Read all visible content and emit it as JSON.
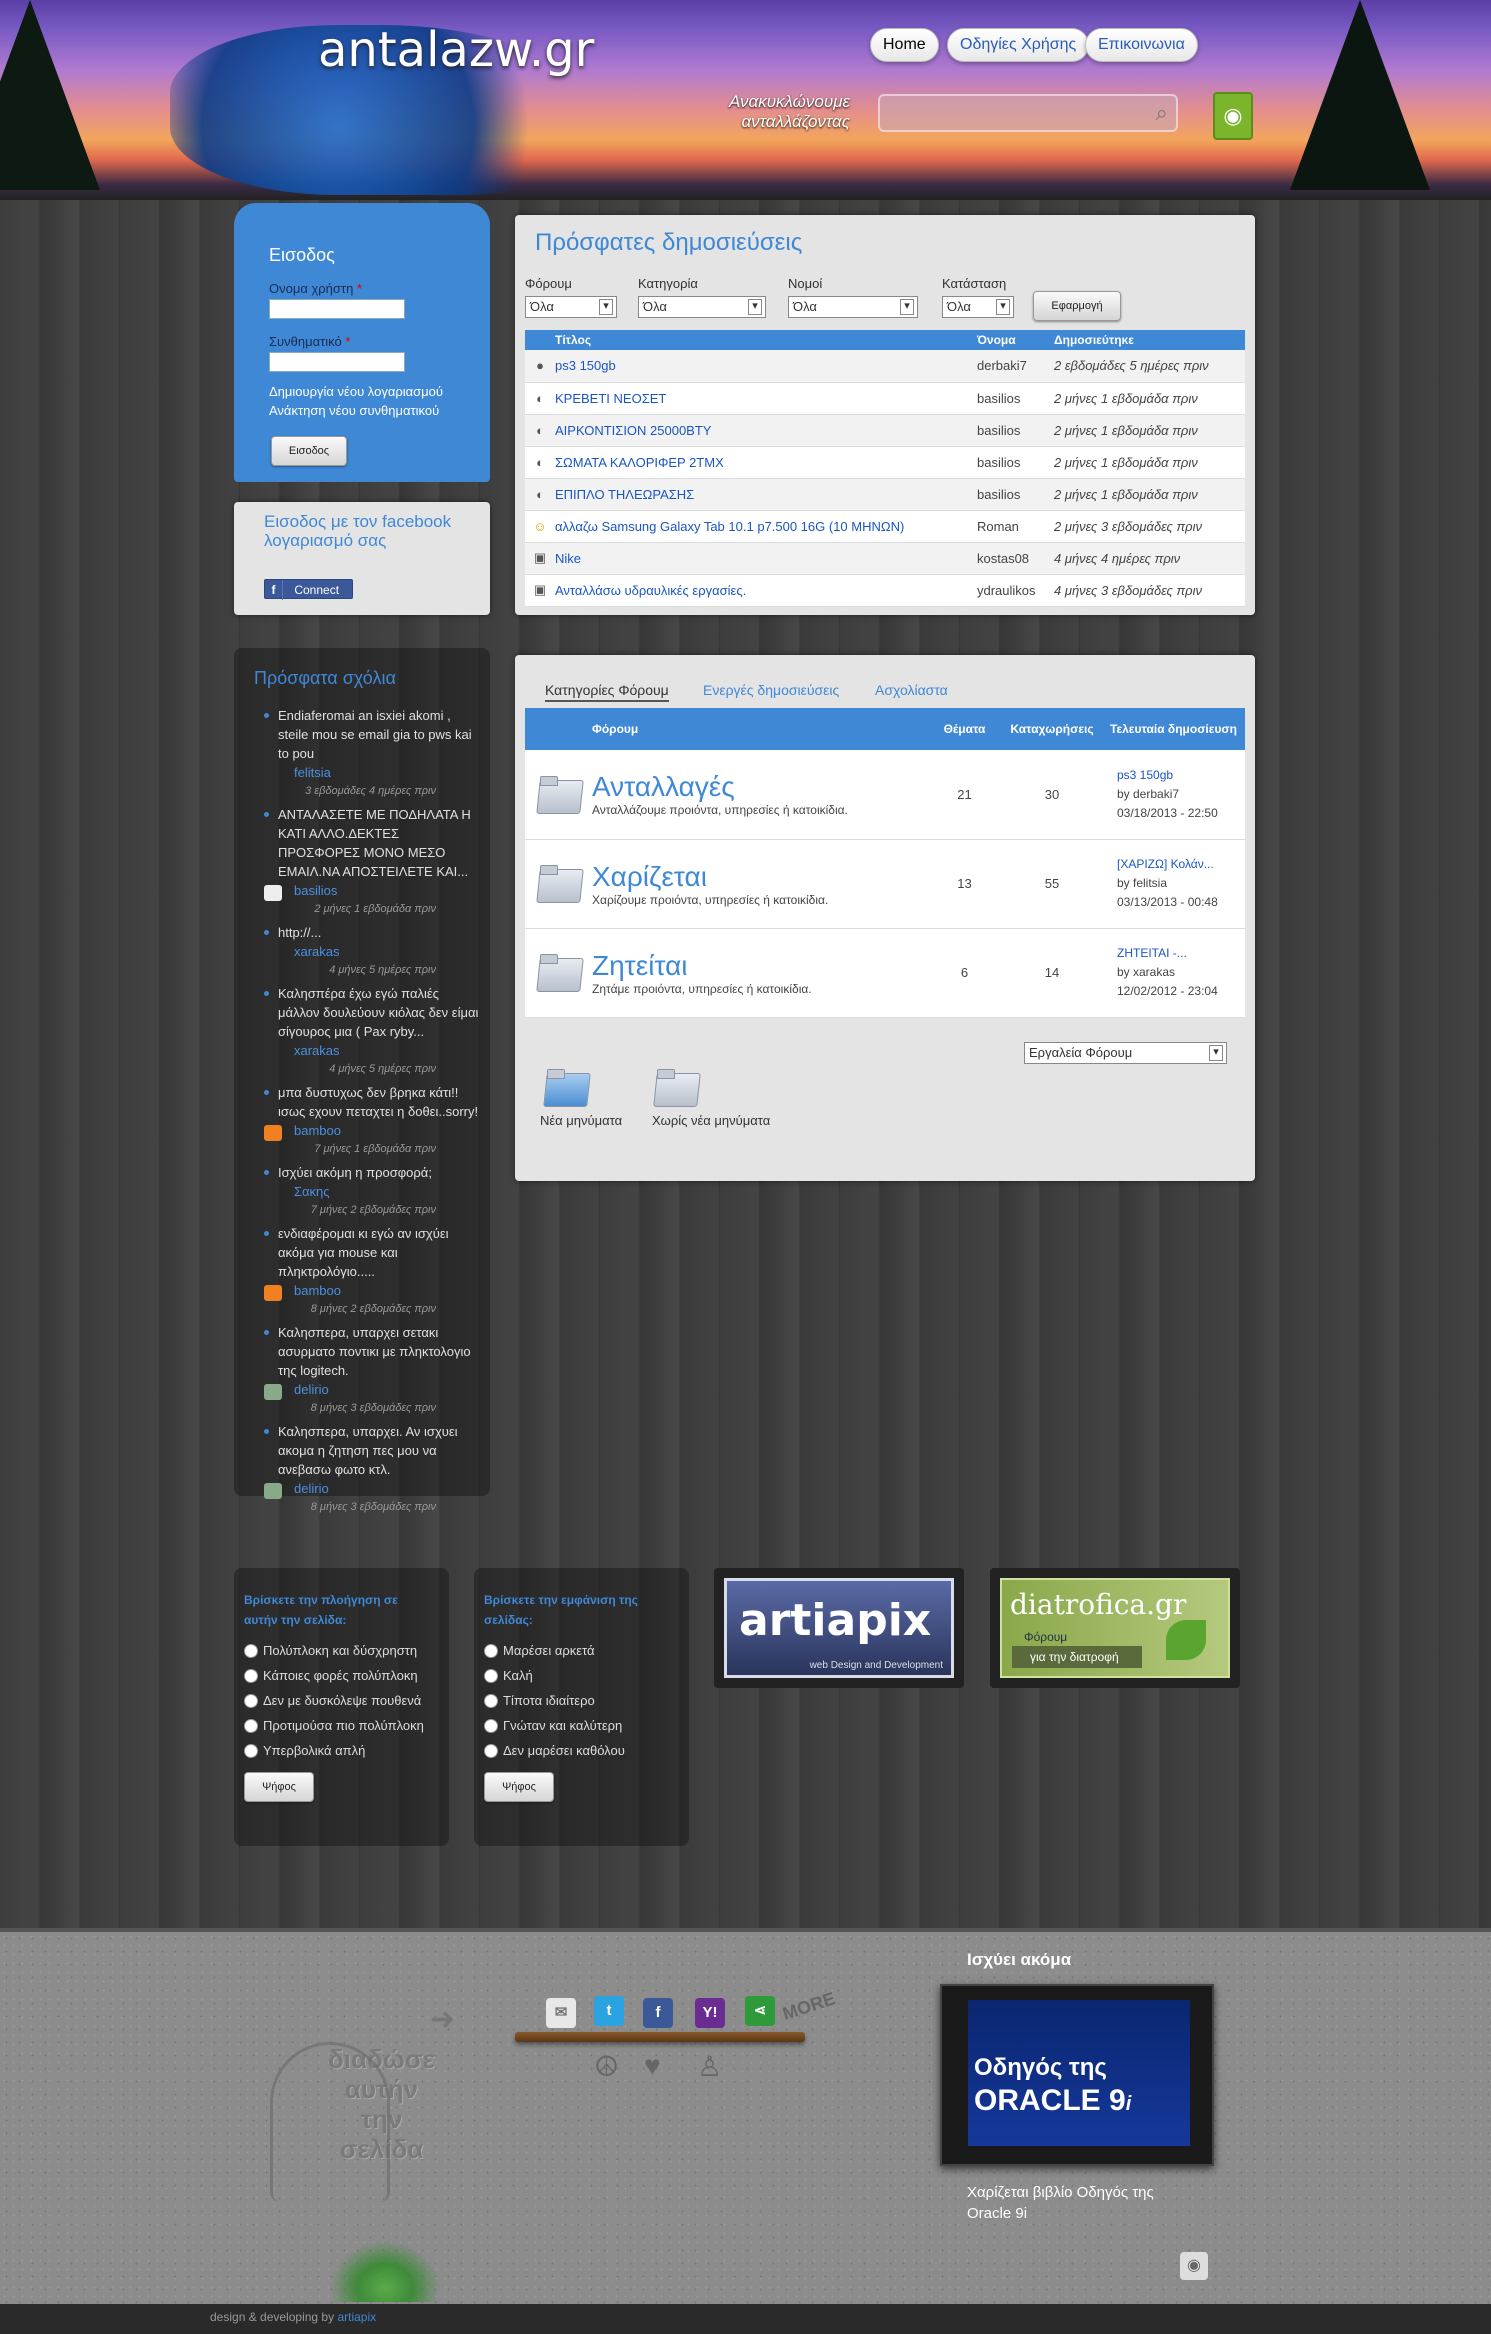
{
  "header": {
    "logo": "antalazw.gr",
    "slogan_line1": "Ανακυκλώνουμε",
    "slogan_line2": "ανταλλάζοντας",
    "nav": [
      "Home",
      "Οδηγίες Χρήσης",
      "Επικοινωνια"
    ]
  },
  "login": {
    "title": "Εισοδος",
    "username_label": "Ονομα χρήστη",
    "password_label": "Συνθηματικό",
    "required_mark": "*",
    "create_account": "Δημιουργία νέου λογαριασμού",
    "reset_password": "Ανάκτηση νέου συνθηματικού",
    "submit": "Εισοδος"
  },
  "facebook": {
    "title": "Εισοδος με τον facebook λογαριασμό σας",
    "button": "Connect",
    "button_icon": "f"
  },
  "comments": {
    "title": "Πρόσφατα σχόλια",
    "items": [
      {
        "text": "Endiaferomai an isxiei akomi , steile mou se email gia to pws kai to pou",
        "user": "felitsia",
        "time": "3 εβδομάδες 4 ημέρες πριν"
      },
      {
        "text": "ΑΝΤΑΛΑΣΕΤΕ ΜΕ ΠΟΔΗΛΑΤΑ Η ΚΑΤΙ ΑΛΛΟ.ΔΕΚΤΕΣ ΠΡΟΣΦΟΡΕΣ ΜΟΝΟ ΜΕΣΟ ΕΜΑΙΛ.ΝΑ ΑΠΟΣΤΕΙΛΕΤΕ ΚΑΙ...",
        "user": "basilios",
        "time": "2 μήνες 1 εβδομάδα πριν"
      },
      {
        "text": "http://...",
        "user": "xarakas",
        "time": "4 μήνες 5 ημέρες πριν"
      },
      {
        "text": "Καλησπέρα έχω εγώ παλιές μάλλον δουλεύουν κιόλας δεν είμαι σίγουρος μια ( Pax ryby...",
        "user": "xarakas",
        "time": "4 μήνες 5 ημέρες πριν"
      },
      {
        "text": "μπα δυστυχως δεν βρηκα κάτι!!ισως εχουν πεταχτει η δοθει..sorry!",
        "user": "bamboo",
        "time": "7 μήνες 1 εβδομάδα πριν"
      },
      {
        "text": "Ισχύει ακόμη η προσφορά;",
        "user": "Σακης",
        "time": "7 μήνες 2 εβδομάδες πριν"
      },
      {
        "text": "ενδιαφέρομαι κι εγώ αν ισχύει ακόμα για mouse και πληκτρολόγιο.....",
        "user": "bamboo",
        "time": "8 μήνες 2 εβδομάδες πριν"
      },
      {
        "text": "Καλησπερα, υπαρχει σετακι ασυρματο ποντικι με πληκτολογιο της logitech.",
        "user": "delirio",
        "time": "8 μήνες 3 εβδομάδες πριν"
      },
      {
        "text": "Καλησπερα, υπαρχει. Αν ισχυει ακομα η ζητηση πες μου να ανεβασω φωτο κτλ.",
        "user": "delirio",
        "time": "8 μήνες 3 εβδομάδες πριν"
      }
    ]
  },
  "recent": {
    "title": "Πρόσφατες δημοσιεύσεις",
    "filters": [
      {
        "label": "Φόρουμ",
        "value": "Όλα"
      },
      {
        "label": "Κατηγορία",
        "value": "Όλα"
      },
      {
        "label": "Νομοί",
        "value": "Όλα"
      },
      {
        "label": "Κατάσταση",
        "value": "Όλα"
      }
    ],
    "apply": "Εφαρμογή",
    "columns": [
      "Τίτλος",
      "Όνομα",
      "Δημοσιεύτηκε"
    ],
    "rows": [
      {
        "title": "ps3 150gb",
        "user": "derbaki7",
        "time": "2 εβδομάδες 5 ημέρες πριν"
      },
      {
        "title": "ΚΡΕΒΕΤΙ ΝΕΟΣΕΤ",
        "user": "basilios",
        "time": "2 μήνες 1 εβδομάδα πριν"
      },
      {
        "title": "ΑΙΡΚΟΝΤΙΣΙΟΝ 25000BTY",
        "user": "basilios",
        "time": "2 μήνες 1 εβδομάδα πριν"
      },
      {
        "title": "ΣΩΜΑΤΑ ΚΑΛΟΡΙΦΕΡ 2ΤΜΧ",
        "user": "basilios",
        "time": "2 μήνες 1 εβδομάδα πριν"
      },
      {
        "title": "ΕΠΙΠΛΟ ΤΗΛΕΩΡΑΣΗΣ",
        "user": "basilios",
        "time": "2 μήνες 1 εβδομάδα πριν"
      },
      {
        "title": "αλλαζω Samsung Galaxy Tab 10.1 p7.500 16G (10 ΜΗΝΩΝ)",
        "user": "Roman",
        "time": "2 μήνες 3 εβδομάδες πριν"
      },
      {
        "title": "Nike",
        "user": "kostas08",
        "time": "4 μήνες 4 ημέρες πριν"
      },
      {
        "title": "Ανταλλάσω υδραυλικές εργασίες.",
        "user": "ydraulikos",
        "time": "4 μήνες 3 εβδομάδες πριν"
      }
    ]
  },
  "forum": {
    "tabs": [
      "Κατηγορίες Φόρουμ",
      "Ενεργές δημοσιεύσεις",
      "Ασχολίαστα"
    ],
    "columns": [
      "Φόρουμ",
      "Θέματα",
      "Καταχωρήσεις",
      "Τελευταία δημοσίευση"
    ],
    "rows": [
      {
        "name": "Ανταλλαγές",
        "desc": "Ανταλλάζουμε προιόντα, υπηρεσίες ή κατοικίδια.",
        "topics": "21",
        "posts": "30",
        "last_title": "ps3 150gb",
        "last_by": "by derbaki7",
        "last_date": "03/18/2013 - 22:50"
      },
      {
        "name": "Χαρίζεται",
        "desc": "Χαρίζουμε προιόντα, υπηρεσίες ή κατοικίδια.",
        "topics": "13",
        "posts": "55",
        "last_title": "[ΧΑΡΙΖΩ] Κολάν...",
        "last_by": "by felitsia",
        "last_date": "03/13/2013 - 00:48"
      },
      {
        "name": "Ζητείται",
        "desc": "Ζητάμε προιόντα, υπηρεσίες ή κατοικίδια.",
        "topics": "6",
        "posts": "14",
        "last_title": "ΖΗΤΕΙΤΑΙ -...",
        "last_by": "by xarakas",
        "last_date": "12/02/2012 - 23:04"
      }
    ],
    "tools": "Εργαλεία Φόρουμ",
    "legend_new": "Νέα μηνύματα",
    "legend_none": "Χωρίς νέα μηνύματα"
  },
  "poll1": {
    "question": "Βρίσκετε την πλοήγηση σε αυτήν την σελίδα:",
    "options": [
      "Πολύπλοκη και δύσχρηστη",
      "Κάποιες φορές πολύπλοκη",
      "Δεν με δυσκόλεψε πουθενά",
      "Προτιμούσα πιο πολύπλοκη",
      "Υπερβολικά απλή"
    ],
    "vote": "Ψήφος"
  },
  "poll2": {
    "question": "Βρίσκετε την εμφάνιση της σελίδας:",
    "options": [
      "Μαρέσει αρκετά",
      "Καλή",
      "Τίποτα ιδιαίτερο",
      "Γνώταν και καλύτερη",
      "Δεν μαρέσει καθόλου"
    ],
    "vote": "Ψήφος"
  },
  "banners": {
    "artiapix": "artiapix",
    "artiapix_sub": "web Design and Development",
    "diatrofica": "diatrofica.gr",
    "diatrofica_sub1": "Φόρουμ",
    "diatrofica_sub2": "για την διατροφή"
  },
  "footer": {
    "share_words": [
      "διαδώσε",
      "αυτήν",
      "την",
      "σελίδα"
    ],
    "more": "MORE",
    "featured_title": "Ισχύει ακόμα",
    "book_title_line1": "Οδηγός της",
    "book_title_line2": "ORACLE 9",
    "book_title_sup": "i",
    "featured_caption": "Χαρίζεται βιβλίο Οδηγός της Oracle 9i",
    "credit_text": "design & developing by",
    "credit_link": "artiapix"
  },
  "colors": {
    "accent": "#3f88d6",
    "link": "#1a55c4",
    "panel": "#e4e4e4"
  }
}
